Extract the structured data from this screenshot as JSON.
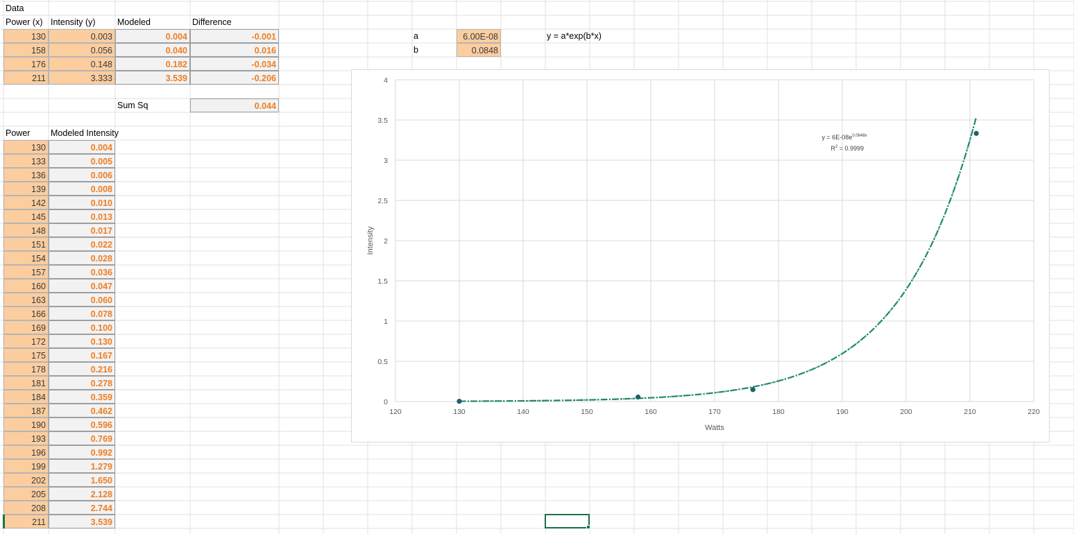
{
  "sheet": {
    "data_title": "Data",
    "headers": {
      "power_x": "Power (x)",
      "intensity_y": "Intensity (y)",
      "modeled": "Modeled",
      "difference": "Difference"
    },
    "rows": [
      {
        "power": "130",
        "intensity": "0.003",
        "modeled": "0.004",
        "difference": "-0.001"
      },
      {
        "power": "158",
        "intensity": "0.056",
        "modeled": "0.040",
        "difference": "0.016"
      },
      {
        "power": "176",
        "intensity": "0.148",
        "modeled": "0.182",
        "difference": "-0.034"
      },
      {
        "power": "211",
        "intensity": "3.333",
        "modeled": "3.539",
        "difference": "-0.206"
      }
    ],
    "sum_sq_label": "Sum Sq",
    "sum_sq_value": "0.044",
    "params": {
      "a_label": "a",
      "a_value": "6.00E-08",
      "b_label": "b",
      "b_value": "0.0848",
      "formula_text": "y = a*exp(b*x)"
    },
    "table2": {
      "header_power": "Power",
      "header_modeled": "Modeled Intensity",
      "rows": [
        {
          "power": "130",
          "value": "0.004"
        },
        {
          "power": "133",
          "value": "0.005"
        },
        {
          "power": "136",
          "value": "0.006"
        },
        {
          "power": "139",
          "value": "0.008"
        },
        {
          "power": "142",
          "value": "0.010"
        },
        {
          "power": "145",
          "value": "0.013"
        },
        {
          "power": "148",
          "value": "0.017"
        },
        {
          "power": "151",
          "value": "0.022"
        },
        {
          "power": "154",
          "value": "0.028"
        },
        {
          "power": "157",
          "value": "0.036"
        },
        {
          "power": "160",
          "value": "0.047"
        },
        {
          "power": "163",
          "value": "0.060"
        },
        {
          "power": "166",
          "value": "0.078"
        },
        {
          "power": "169",
          "value": "0.100"
        },
        {
          "power": "172",
          "value": "0.130"
        },
        {
          "power": "175",
          "value": "0.167"
        },
        {
          "power": "178",
          "value": "0.216"
        },
        {
          "power": "181",
          "value": "0.278"
        },
        {
          "power": "184",
          "value": "0.359"
        },
        {
          "power": "187",
          "value": "0.462"
        },
        {
          "power": "190",
          "value": "0.596"
        },
        {
          "power": "193",
          "value": "0.769"
        },
        {
          "power": "196",
          "value": "0.992"
        },
        {
          "power": "199",
          "value": "1.279"
        },
        {
          "power": "202",
          "value": "1.650"
        },
        {
          "power": "205",
          "value": "2.128"
        },
        {
          "power": "208",
          "value": "2.744"
        },
        {
          "power": "211",
          "value": "3.539"
        }
      ]
    }
  },
  "colors": {
    "input_fill": "#fbcd9f",
    "calc_fill": "#f2f2f2",
    "calc_text": "#ef7e22",
    "marker": "#1f5f6e",
    "trend_exp": "#1f6f8b",
    "trend_model": "#1e9a55",
    "selection": "#1e7145"
  },
  "chart_data": {
    "type": "scatter",
    "title": "",
    "xlabel": "Watts",
    "ylabel": "Intensity",
    "xlim": [
      120,
      220
    ],
    "ylim": [
      0,
      4
    ],
    "x_ticks": [
      "120",
      "130",
      "140",
      "150",
      "160",
      "170",
      "180",
      "190",
      "200",
      "210",
      "220"
    ],
    "y_ticks": [
      "0",
      "0.5",
      "1",
      "1.5",
      "2",
      "2.5",
      "3",
      "3.5",
      "4"
    ],
    "grid": true,
    "series": [
      {
        "x": [
          130,
          158,
          176,
          211
        ],
        "y": [
          0.003,
          0.056,
          0.148,
          3.333
        ]
      }
    ],
    "trendline": {
      "kind": "exponential",
      "a": 6e-08,
      "b": 0.0848,
      "eq_prefix": "y = 6E-08e",
      "eq_exponent": "0.0848x",
      "r2_prefix": "R",
      "r2_sup": "2",
      "r2_value": " = 0.9999"
    },
    "model_curve": {
      "a": 6e-08,
      "b": 0.0848,
      "x": [
        130,
        133,
        136,
        139,
        142,
        145,
        148,
        151,
        154,
        157,
        160,
        163,
        166,
        169,
        172,
        175,
        178,
        181,
        184,
        187,
        190,
        193,
        196,
        199,
        202,
        205,
        208,
        211
      ],
      "y": [
        0.004,
        0.005,
        0.006,
        0.008,
        0.01,
        0.013,
        0.017,
        0.022,
        0.028,
        0.036,
        0.047,
        0.06,
        0.078,
        0.1,
        0.13,
        0.167,
        0.216,
        0.278,
        0.359,
        0.462,
        0.596,
        0.769,
        0.992,
        1.279,
        1.65,
        2.128,
        2.744,
        3.539
      ]
    }
  }
}
